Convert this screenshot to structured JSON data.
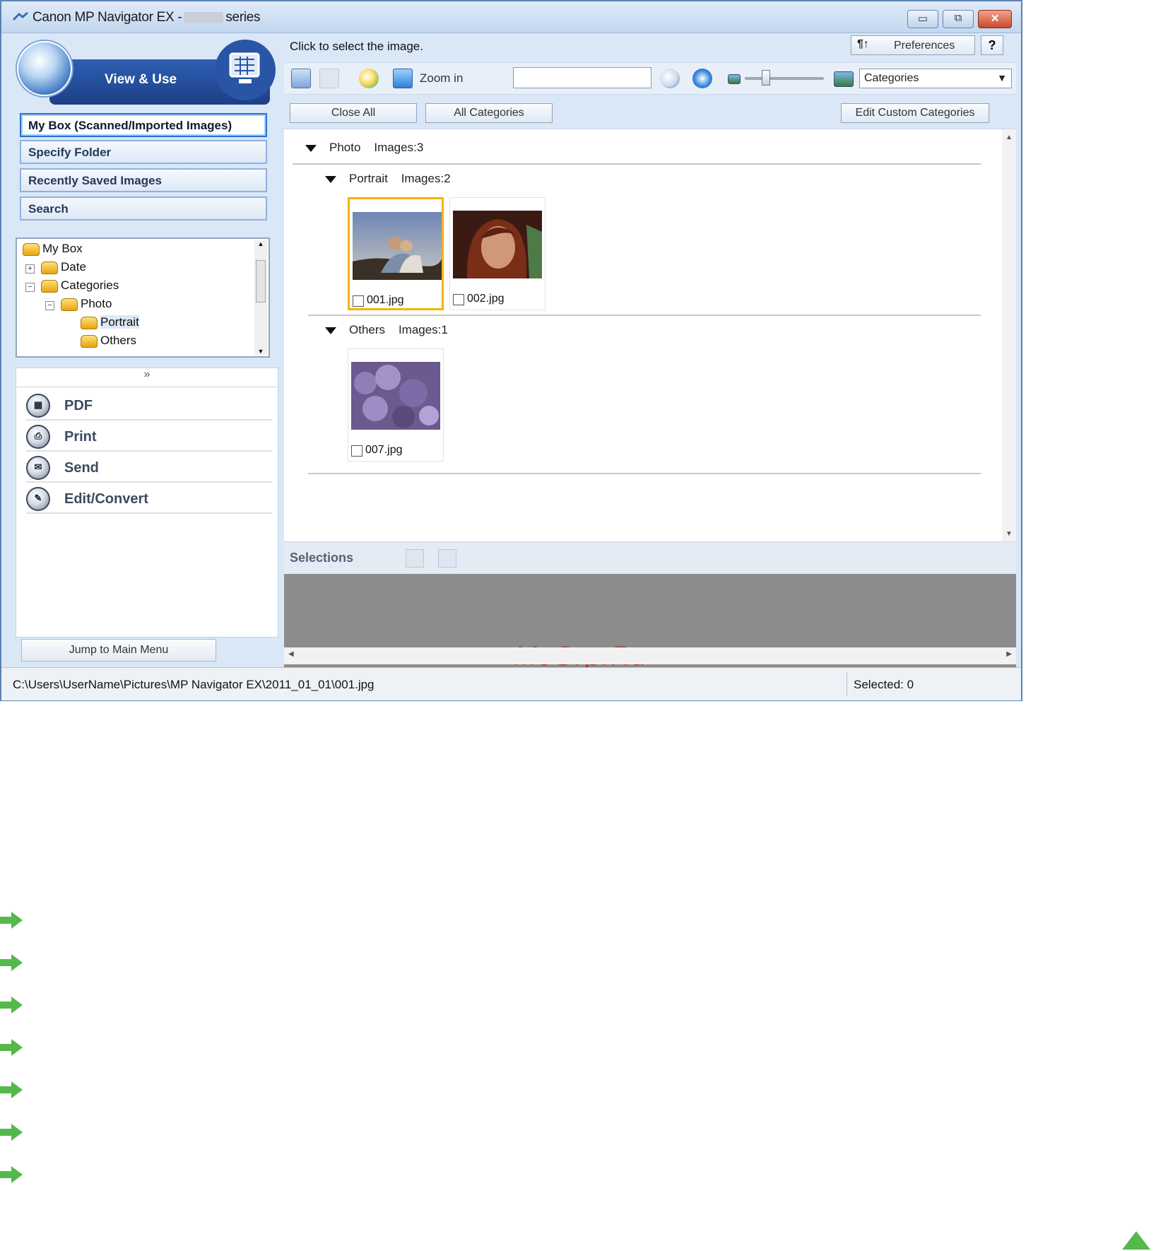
{
  "window": {
    "title_prefix": "Canon MP Navigator EX -",
    "title_suffix": "series",
    "controls": [
      "minimize",
      "maximize",
      "close"
    ]
  },
  "left": {
    "mode_title": "View & Use",
    "nav": [
      {
        "label": "My Box (Scanned/Imported Images)",
        "active": true
      },
      {
        "label": "Specify Folder"
      },
      {
        "label": "Recently Saved Images"
      },
      {
        "label": "Search"
      }
    ],
    "tree": [
      {
        "label": "My Box"
      },
      {
        "label": "Date"
      },
      {
        "label": "Categories"
      },
      {
        "label": "Photo"
      },
      {
        "label": "Portrait",
        "selected": true
      },
      {
        "label": "Others"
      }
    ],
    "collapse_glyph": "»",
    "actions": [
      {
        "label": "PDF",
        "icon": "pdf-icon"
      },
      {
        "label": "Print",
        "icon": "print-icon"
      },
      {
        "label": "Send",
        "icon": "send-icon"
      },
      {
        "label": "Edit/Convert",
        "icon": "edit-convert-icon"
      }
    ],
    "jump_label": "Jump to Main Menu"
  },
  "right": {
    "hint": "Click to select the image.",
    "preferences_label": "Preferences",
    "help_label": "?",
    "zoom_label": "Zoom in",
    "search_value": "",
    "category_select": "Categories",
    "close_all": "Close All",
    "all_categories": "All Categories",
    "edit_custom": "Edit Custom Categories",
    "groups": {
      "photo": {
        "name": "Photo",
        "count": "Images:3"
      },
      "portrait": {
        "name": "Portrait",
        "count": "Images:2"
      },
      "others": {
        "name": "Others",
        "count": "Images:1"
      }
    },
    "images": [
      {
        "name": "001.jpg",
        "selected": true,
        "checked": false
      },
      {
        "name": "002.jpg",
        "selected": false,
        "checked": false
      },
      {
        "name": "007.jpg",
        "selected": false,
        "checked": false
      }
    ],
    "selections_label": "Selections",
    "watermark": "McGrp.Ru"
  },
  "status": {
    "path": "C:\\Users\\UserName\\Pictures\\MP Navigator EX\\2011_01_01\\001.jpg",
    "selected": "Selected: 0"
  },
  "colors": {
    "accent": "#1d3f86",
    "selection_border": "#f4b400",
    "link_arrow": "#55b84a",
    "watermark": "#c0291f"
  }
}
